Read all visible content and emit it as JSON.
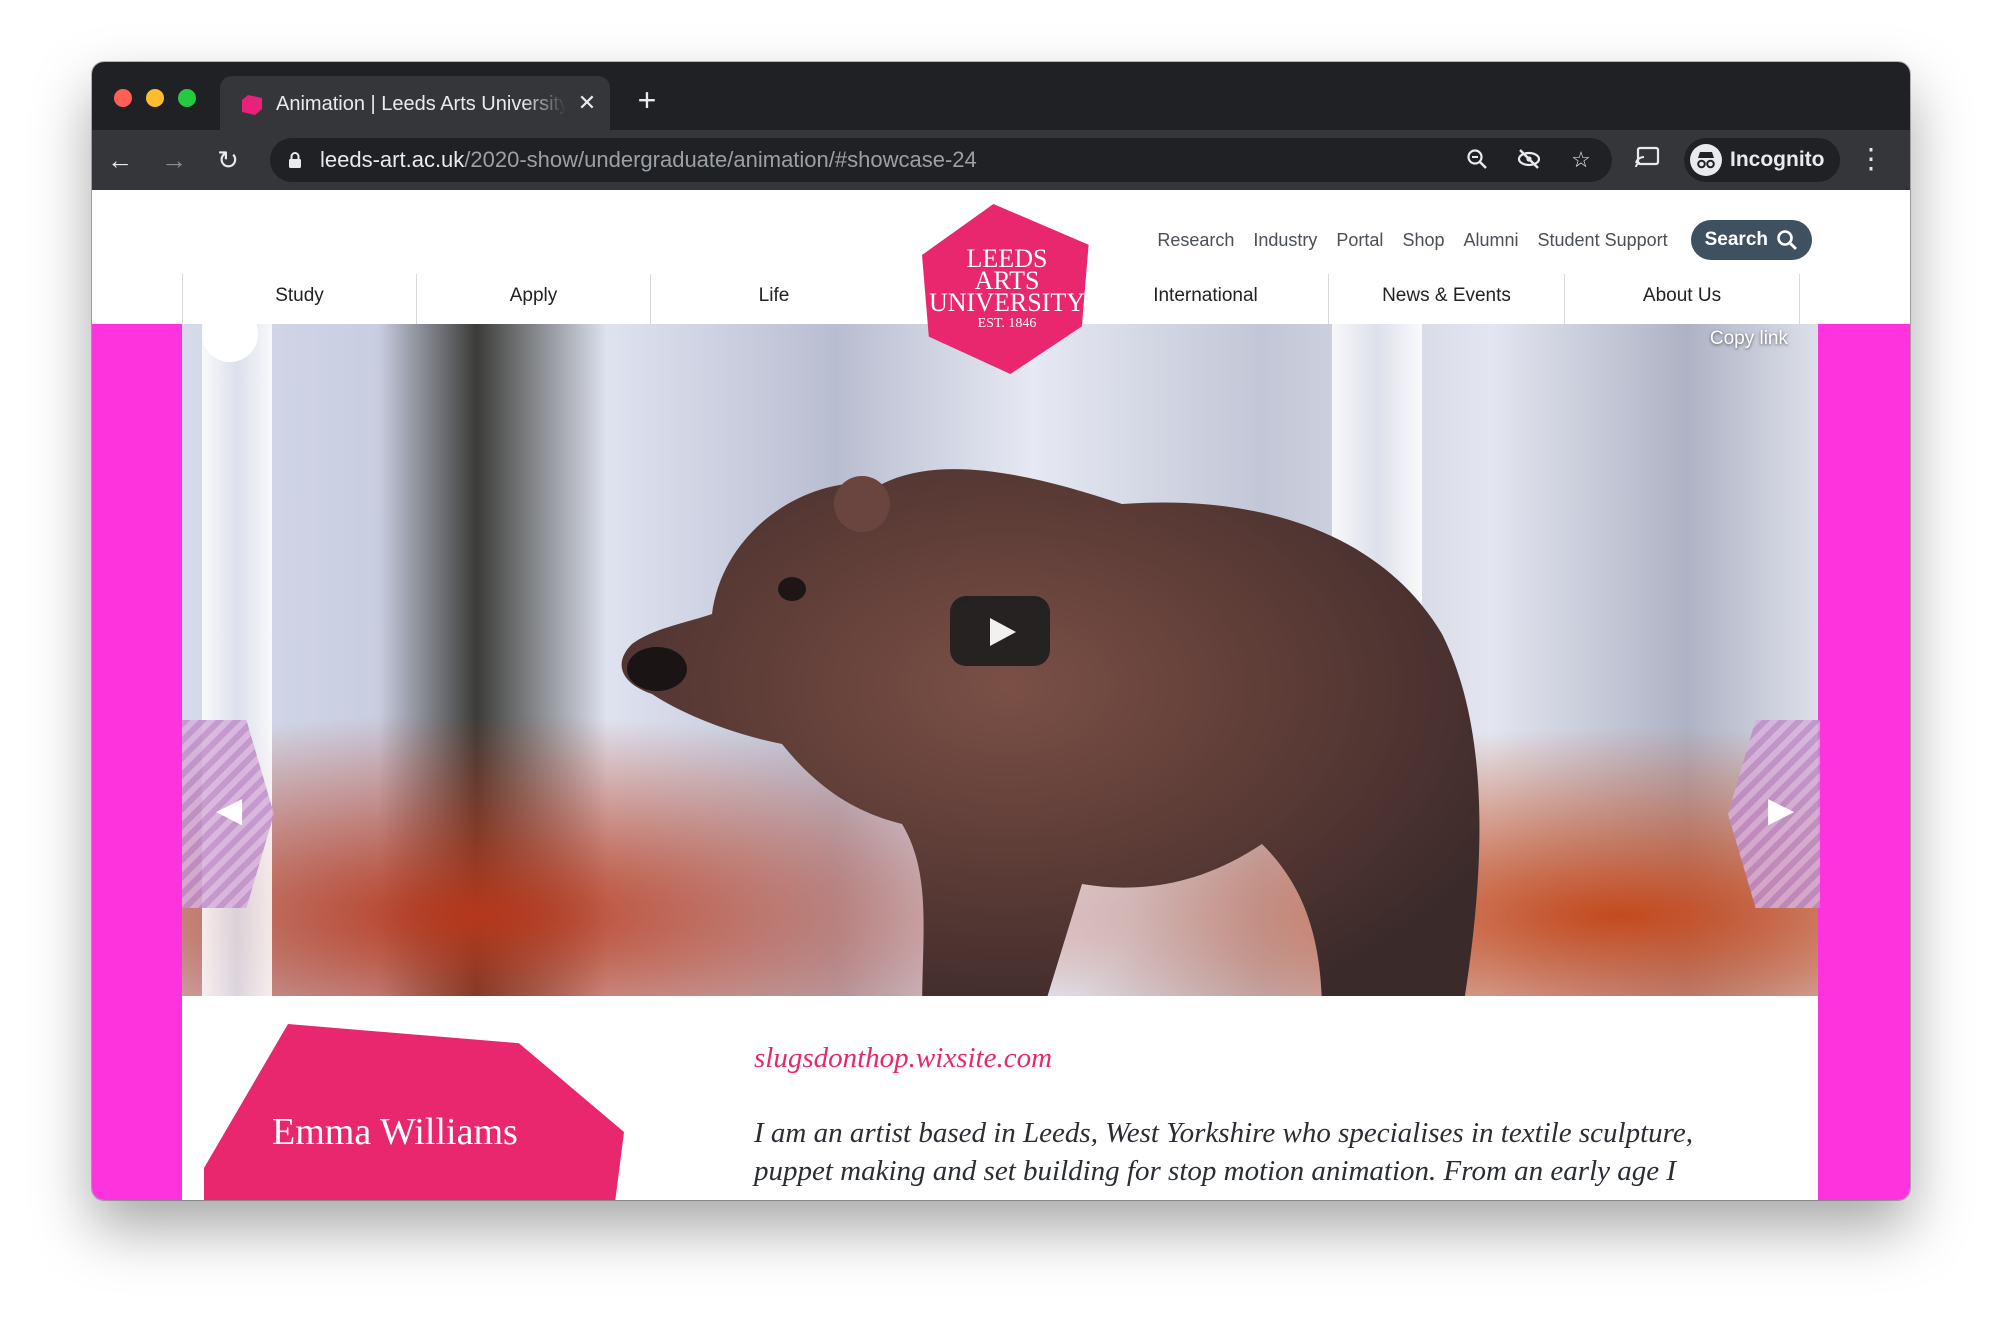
{
  "browser": {
    "tab_title": "Animation | Leeds Arts University",
    "url_host": "leeds-art.ac.uk",
    "url_path": "/2020-show/undergraduate/animation/#showcase-24",
    "profile_label": "Incognito",
    "icons": {
      "back": "back-arrow-icon",
      "forward": "forward-arrow-icon",
      "reload": "reload-icon",
      "zoom": "zoom-icon",
      "tracking": "eye-off-icon",
      "bookmark": "star-icon",
      "cast": "cast-icon",
      "menu": "kebab-menu-icon"
    }
  },
  "header": {
    "utility_links": [
      "Research",
      "Industry",
      "Portal",
      "Shop",
      "Alumni",
      "Student Support"
    ],
    "search_label": "Search",
    "logo": {
      "line1": "LEEDS",
      "line2": "ARTS",
      "line3": "UNIVERSITY",
      "est": "EST. 1846"
    },
    "nav_left": [
      "Study",
      "Apply",
      "Life"
    ],
    "nav_right": [
      "International",
      "News & Events",
      "About Us"
    ]
  },
  "video": {
    "copy_link": "Copy link",
    "prev_glyph": "◀",
    "next_glyph": "▶"
  },
  "bio": {
    "name": "Emma Williams",
    "website": "slugsdonthop.wixsite.com",
    "text": "I am an artist based in Leeds, West Yorkshire who specialises in textile sculpture, puppet making and set building for stop motion animation. From an early age I"
  },
  "colors": {
    "brand_pink": "#e8276f",
    "page_magenta": "#ff33dd",
    "search_button": "#3f5060"
  }
}
